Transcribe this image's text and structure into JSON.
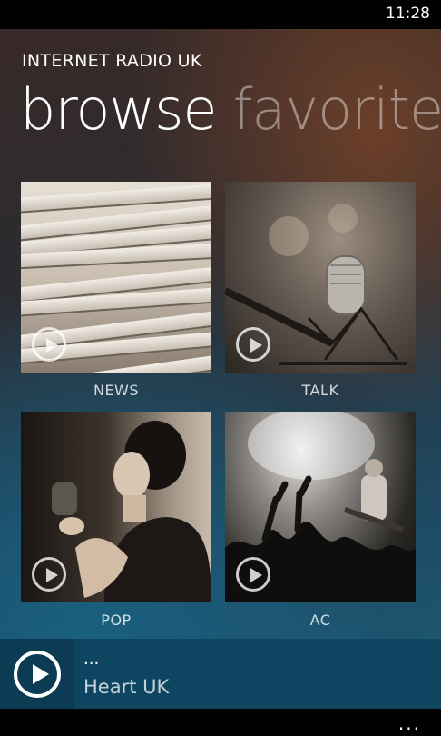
{
  "status_bar": {
    "time": "11:28"
  },
  "app": {
    "title": "INTERNET RADIO UK"
  },
  "pivot": {
    "active": "browse",
    "next": "favorites"
  },
  "genres": [
    {
      "label": "NEWS"
    },
    {
      "label": "TALK"
    },
    {
      "label": "POP"
    },
    {
      "label": "AC"
    }
  ],
  "now_playing": {
    "line1": "...",
    "station": "Heart UK"
  },
  "app_bar": {
    "more": "..."
  },
  "icons": [
    "play-circle-icon",
    "more-icon"
  ]
}
